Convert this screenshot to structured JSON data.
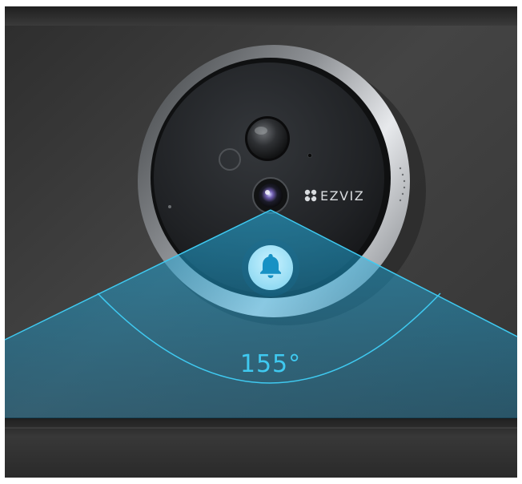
{
  "scene": {
    "subject": "doorbell-camera-peephole",
    "icons": [
      "camera-lens-icon",
      "pir-sensor-icon",
      "light-sensor-icon",
      "bell-icon",
      "ezviz-logo-icon"
    ],
    "colors": {
      "wall": "#3b3b3b",
      "bezel": "#b9bcbf",
      "face": "#1e2023",
      "fov_overlay": "#1aa5d8",
      "fov_text": "#3fc9f0",
      "bell_button": "#a8e6f7"
    }
  },
  "brand": {
    "name": "EZVIZ"
  },
  "fov": {
    "label": "155°",
    "angle_degrees": 155
  }
}
